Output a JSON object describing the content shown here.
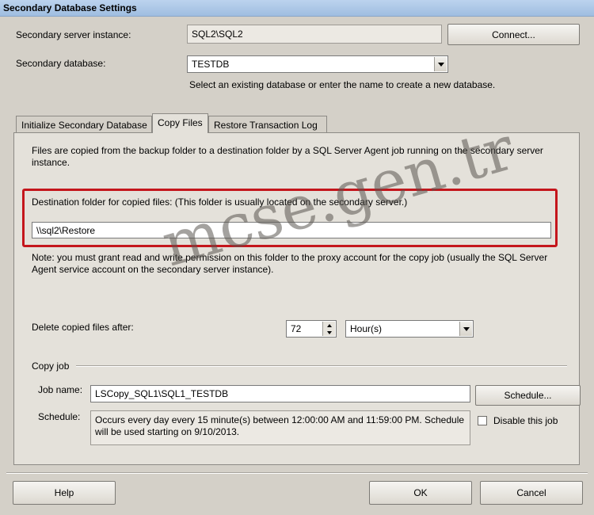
{
  "window": {
    "title": "Secondary Database Settings"
  },
  "server": {
    "label": "Secondary server instance:",
    "value": "SQL2\\SQL2",
    "connect_button": "Connect..."
  },
  "database": {
    "label": "Secondary database:",
    "value": "TESTDB",
    "hint": "Select an existing database or enter the name to create a new database."
  },
  "tabs": [
    {
      "label": "Initialize Secondary Database"
    },
    {
      "label": "Copy Files"
    },
    {
      "label": "Restore Transaction Log"
    }
  ],
  "copy_files": {
    "description": "Files are copied from the backup folder to a destination folder by a SQL Server Agent job running on the secondary server instance.",
    "dest_label": "Destination folder for copied files: (This folder is usually located on the secondary server.)",
    "dest_value": "\\\\sql2\\Restore",
    "note": "Note: you must grant read and write permission on this folder to the proxy account for the copy job (usually the SQL Server Agent service account on the secondary server instance).",
    "delete_label": "Delete copied files after:",
    "delete_value": "72",
    "delete_unit": "Hour(s)"
  },
  "copy_job": {
    "section_label": "Copy job",
    "job_name_label": "Job name:",
    "job_name_value": "LSCopy_SQL1\\SQL1_TESTDB",
    "schedule_button": "Schedule...",
    "schedule_label": "Schedule:",
    "schedule_text": "Occurs every day every 15 minute(s) between 12:00:00 AM and 11:59:00 PM. Schedule will be used starting on 9/10/2013.",
    "disable_label": "Disable this job"
  },
  "footer": {
    "help": "Help",
    "ok": "OK",
    "cancel": "Cancel"
  },
  "watermark": {
    "text": "mcse.gen.tr"
  },
  "colors": {
    "highlight_border": "#c4161c",
    "title_bar": "#bcd3ee"
  }
}
